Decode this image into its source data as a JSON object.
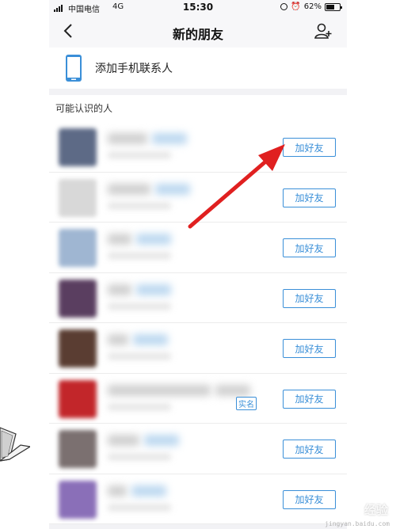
{
  "status_bar": {
    "carrier": "中国电信",
    "network": "4G",
    "time": "15:30",
    "battery": "62%",
    "battery_level": 0.62
  },
  "header": {
    "title": "新的朋友"
  },
  "contacts_entry": {
    "label": "添加手机联系人",
    "icon": "phone-icon"
  },
  "section": {
    "title": "可能认识的人"
  },
  "people": [
    {
      "button_label": "加好友",
      "avatar_color": "#5d6a86",
      "name_color": "#bcd8f0"
    },
    {
      "button_label": "加好友",
      "avatar_color": "#d8d8d8",
      "name_color": "#bcd8f0"
    },
    {
      "button_label": "加好友",
      "avatar_color": "#9fb6d2",
      "name_color": "#bcd8f0"
    },
    {
      "button_label": "加好友",
      "avatar_color": "#5a3e60",
      "name_color": "#bcd8f0"
    },
    {
      "button_label": "加好友",
      "avatar_color": "#5a3d32",
      "name_color": "#bcd8f0"
    },
    {
      "button_label": "加好友",
      "avatar_color": "#c2262a",
      "name_color": "#d0d0d0",
      "badge": "实名"
    },
    {
      "button_label": "加好友",
      "avatar_color": "#7b7070",
      "name_color": "#bcd8f0"
    },
    {
      "button_label": "加好友",
      "avatar_color": "#8a6fb8",
      "name_color": "#bcd8f0"
    }
  ],
  "watermark": {
    "text": "经验",
    "sub": "jingyan.baidu.com"
  },
  "colors": {
    "accent": "#3a8fd8",
    "arrow": "#e02020"
  }
}
